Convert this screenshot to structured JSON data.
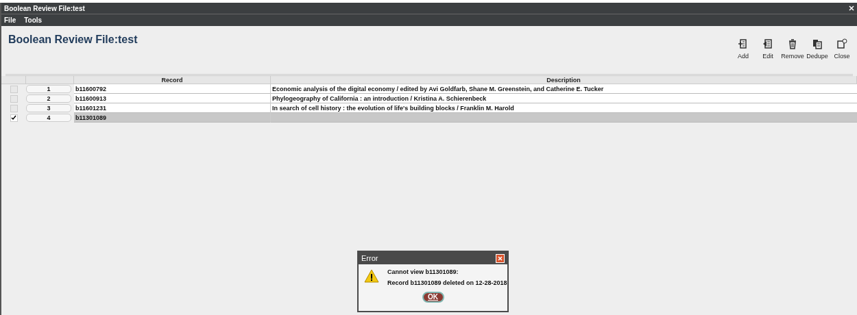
{
  "window": {
    "title": "Boolean Review File:test"
  },
  "menu": [
    "File",
    "Tools"
  ],
  "heading": "Boolean Review File:test",
  "toolbar": [
    {
      "label": "Add",
      "kind": "add"
    },
    {
      "label": "Edit",
      "kind": "edit"
    },
    {
      "label": "Remove",
      "kind": "remove"
    },
    {
      "label": "Dedupe",
      "kind": "dedupe"
    },
    {
      "label": "Close",
      "kind": "close"
    }
  ],
  "table": {
    "columns": [
      "Record",
      "Description"
    ],
    "rows": [
      {
        "number": "1",
        "record": "b11600792",
        "description": "Economic analysis of the digital economy / edited by Avi Goldfarb, Shane M. Greenstein, and Catherine E. Tucker",
        "checked": false,
        "selected": false
      },
      {
        "number": "2",
        "record": "b11600913",
        "description": "Phylogeography of California : an introduction / Kristina A. Schierenbeck",
        "checked": false,
        "selected": false
      },
      {
        "number": "3",
        "record": "b11601231",
        "description": "In search of cell history : the evolution of life's building blocks / Franklin M. Harold",
        "checked": false,
        "selected": false
      },
      {
        "number": "4",
        "record": "b11301089",
        "checked": true,
        "selected": true
      }
    ]
  },
  "dialog": {
    "title": "Error",
    "messages": [
      "Cannot view b11301089:",
      "Record b11301089 deleted on 12-28-2018"
    ],
    "button": "OK"
  }
}
